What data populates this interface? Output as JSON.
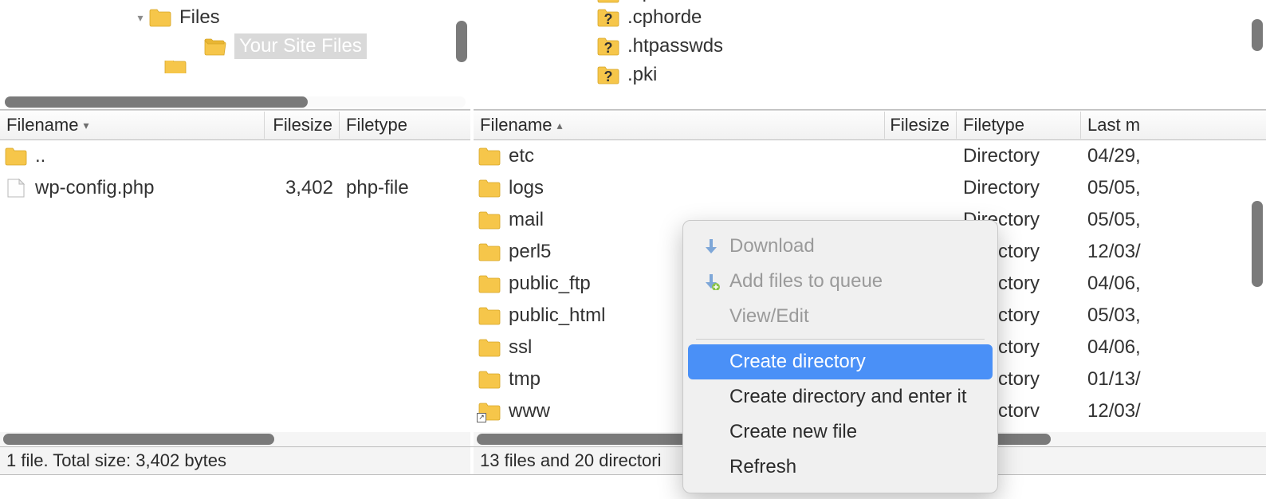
{
  "left": {
    "tree": [
      {
        "indent": 165,
        "disclosure": "down",
        "icon": "folder",
        "label": "Files"
      },
      {
        "indent": 234,
        "disclosure": "",
        "icon": "folder-open",
        "label": "Your Site Files",
        "selected": true
      }
    ],
    "columns": {
      "filename": "Filename",
      "filesize": "Filesize",
      "filetype": "Filetype"
    },
    "rows": [
      {
        "icon": "parent",
        "name": "..",
        "size": "",
        "type": ""
      },
      {
        "icon": "file",
        "name": "wp-config.php",
        "size": "3,402",
        "type": "php-file"
      }
    ],
    "status": "1 file. Total size: 3,402 bytes"
  },
  "right": {
    "tree": [
      {
        "indent": 155,
        "icon": "unknown",
        "label": ".cpanel",
        "cutoff": true
      },
      {
        "indent": 155,
        "icon": "unknown",
        "label": ".cphorde"
      },
      {
        "indent": 155,
        "icon": "unknown",
        "label": ".htpasswds"
      },
      {
        "indent": 155,
        "icon": "unknown",
        "label": ".pki"
      }
    ],
    "columns": {
      "filename": "Filename",
      "filesize": "Filesize",
      "filetype": "Filetype",
      "lastmod": "Last m"
    },
    "rows": [
      {
        "icon": "folder",
        "name": "etc",
        "type": "Directory",
        "mod": "04/29,"
      },
      {
        "icon": "folder",
        "name": "logs",
        "type": "Directory",
        "mod": "05/05,"
      },
      {
        "icon": "folder",
        "name": "mail",
        "type": "Directory",
        "mod": "05/05,"
      },
      {
        "icon": "folder",
        "name": "perl5",
        "type": "Directory",
        "mod": "12/03/"
      },
      {
        "icon": "folder",
        "name": "public_ftp",
        "type": "Directory",
        "mod": "04/06,"
      },
      {
        "icon": "folder",
        "name": "public_html",
        "type": "Directory",
        "mod": "05/03,"
      },
      {
        "icon": "folder",
        "name": "ssl",
        "type": "Directory",
        "mod": "04/06,"
      },
      {
        "icon": "folder",
        "name": "tmp",
        "type": "Directory",
        "mod": "01/13/"
      },
      {
        "icon": "folder-link",
        "name": "www",
        "type": "Directorv",
        "mod": "12/03/"
      }
    ],
    "status": "13 files and 20 directori"
  },
  "context_menu": {
    "download": "Download",
    "add_queue": "Add files to queue",
    "view_edit": "View/Edit",
    "create_dir": "Create directory",
    "create_dir_enter": "Create directory and enter it",
    "create_file": "Create new file",
    "refresh": "Refresh"
  }
}
